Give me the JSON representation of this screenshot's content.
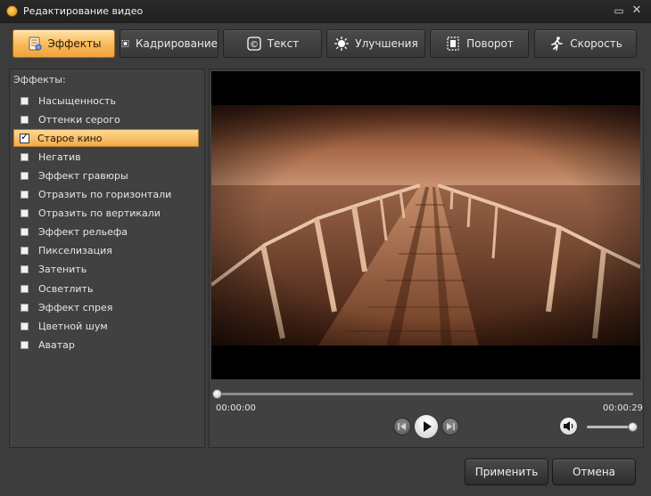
{
  "window": {
    "title": "Редактирование видео"
  },
  "tabs": [
    {
      "label": "Эффекты",
      "icon": "effects-icon",
      "active": true
    },
    {
      "label": "Кадрирование",
      "icon": "crop-icon"
    },
    {
      "label": "Текст",
      "icon": "text-icon"
    },
    {
      "label": "Улучшения",
      "icon": "brightness-icon"
    },
    {
      "label": "Поворот",
      "icon": "rotate-icon"
    },
    {
      "label": "Скорость",
      "icon": "running-man-icon"
    }
  ],
  "effects_panel": {
    "heading": "Эффекты:",
    "items": [
      {
        "label": "Насыщенность",
        "checked": false
      },
      {
        "label": "Оттенки серого",
        "checked": false
      },
      {
        "label": "Старое кино",
        "checked": true
      },
      {
        "label": "Негатив",
        "checked": false
      },
      {
        "label": "Эффект гравюры",
        "checked": false
      },
      {
        "label": "Отразить по горизонтали",
        "checked": false
      },
      {
        "label": "Отразить по вертикали",
        "checked": false
      },
      {
        "label": "Эффект рельефа",
        "checked": false
      },
      {
        "label": "Пикселизация",
        "checked": false
      },
      {
        "label": "Затенить",
        "checked": false
      },
      {
        "label": "Осветлить",
        "checked": false
      },
      {
        "label": "Эффект спрея",
        "checked": false
      },
      {
        "label": "Цветной шум",
        "checked": false
      },
      {
        "label": "Аватар",
        "checked": false
      }
    ]
  },
  "player": {
    "current_time": "00:00:00",
    "duration": "00:00:29",
    "progress": 0,
    "volume": 0.95
  },
  "buttons": {
    "apply": "Применить",
    "cancel": "Отмена"
  },
  "colors": {
    "accent": "#f4ad4a",
    "background": "#3c3c3c",
    "sepia": "#8a4a26"
  }
}
